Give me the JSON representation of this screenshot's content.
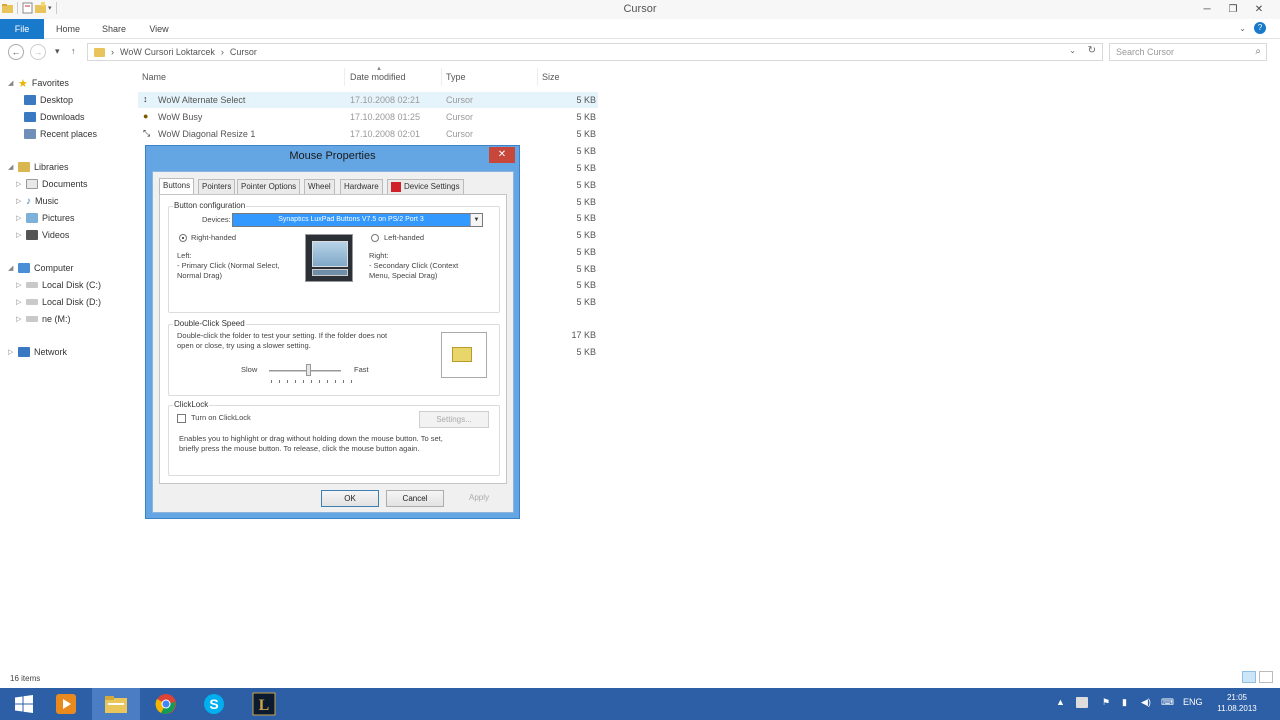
{
  "window": {
    "title": "Cursor",
    "controls": [
      "minimize",
      "restore",
      "close"
    ]
  },
  "ribbon": {
    "tabs": [
      "File",
      "Home",
      "Share",
      "View"
    ]
  },
  "address": {
    "crumbs": [
      "WoW Cursori Loktarcek",
      "Cursor"
    ],
    "search_placeholder": "Search Cursor"
  },
  "navpane": {
    "favorites": {
      "label": "Favorites",
      "items": [
        "Desktop",
        "Downloads",
        "Recent places"
      ]
    },
    "libraries": {
      "label": "Libraries",
      "items": [
        "Documents",
        "Music",
        "Pictures",
        "Videos"
      ]
    },
    "computer": {
      "label": "Computer",
      "items": [
        "Local Disk (C:)",
        "Local Disk (D:)",
        "ne (M:)"
      ]
    },
    "network": {
      "label": "Network"
    }
  },
  "filelist": {
    "columns": {
      "name": "Name",
      "date": "Date modified",
      "type": "Type",
      "size": "Size"
    },
    "rows": [
      {
        "name": "WoW Alternate Select",
        "date": "17.10.2008 02:21",
        "type": "Cursor",
        "size": "5 KB"
      },
      {
        "name": "WoW Busy",
        "date": "17.10.2008 01:25",
        "type": "Cursor",
        "size": "5 KB"
      },
      {
        "name": "WoW Diagonal Resize 1",
        "date": "17.10.2008 02:01",
        "type": "Cursor",
        "size": "5 KB"
      }
    ],
    "hidden_sizes": [
      "5 KB",
      "5 KB",
      "5 KB",
      "5 KB",
      "5 KB",
      "5 KB",
      "5 KB",
      "5 KB",
      "5 KB",
      "5 KB",
      "17 KB",
      "5 KB"
    ]
  },
  "dialog": {
    "title": "Mouse Properties",
    "close": "✕",
    "tabs": [
      "Buttons",
      "Pointers",
      "Pointer Options",
      "Wheel",
      "Hardware",
      "Device Settings"
    ],
    "button_config": {
      "label": "Button configuration",
      "devices_label": "Devices:",
      "device_value": "Synaptics LuxPad Buttons V7.5 on PS/2 Port 3",
      "right_handed": "Right-handed",
      "left_handed": "Left-handed",
      "left_title": "Left:",
      "left_desc1": "- Primary Click (Normal Select,",
      "left_desc2": "Normal Drag)",
      "right_title": "Right:",
      "right_desc1": "- Secondary Click (Context",
      "right_desc2": "Menu, Special Drag)"
    },
    "double_click": {
      "label": "Double-Click Speed",
      "desc1": "Double-click the folder to test your setting.  If the folder does not",
      "desc2": "open or close, try using a slower setting.",
      "slow": "Slow",
      "fast": "Fast",
      "speed": 0.55
    },
    "clicklock": {
      "label": "ClickLock",
      "checkbox": "Turn on ClickLock",
      "settings": "Settings...",
      "desc1": "Enables you to highlight or drag without holding down the mouse button.  To set,",
      "desc2": "briefly press the mouse button.  To release, click the mouse button again."
    },
    "buttons": {
      "ok": "OK",
      "cancel": "Cancel",
      "apply": "Apply"
    }
  },
  "status": {
    "items": "16 items"
  },
  "taskbar": {
    "lang": "ENG",
    "time": "21:05",
    "date": "11.08.2013"
  }
}
